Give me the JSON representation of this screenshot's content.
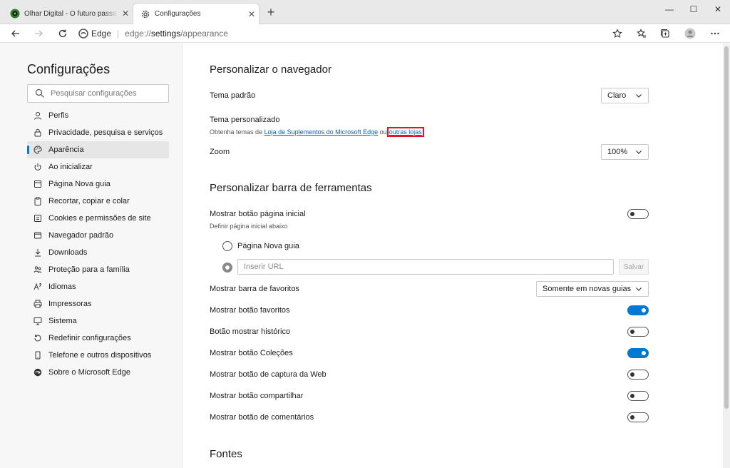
{
  "browser": {
    "tabs": [
      {
        "title": "Olhar Digital - O futuro passa pr",
        "favicon": "olhar-digital-logo",
        "active": false
      },
      {
        "title": "Configurações",
        "favicon": "gear-icon",
        "active": true
      }
    ],
    "new_tab_label": "+",
    "address": {
      "identity": "Edge",
      "separator": "|",
      "url_prefix": "edge://",
      "url_host": "settings",
      "url_path": "/appearance"
    }
  },
  "sidebar": {
    "title": "Configurações",
    "search_placeholder": "Pesquisar configurações",
    "items": [
      {
        "label": "Perfis",
        "icon": "person-icon"
      },
      {
        "label": "Privacidade, pesquisa e serviços",
        "icon": "lock-icon"
      },
      {
        "label": "Aparência",
        "icon": "palette-icon",
        "selected": true
      },
      {
        "label": "Ao inicializar",
        "icon": "power-icon"
      },
      {
        "label": "Página Nova guia",
        "icon": "new-tab-icon"
      },
      {
        "label": "Recortar, copiar e colar",
        "icon": "clipboard-icon"
      },
      {
        "label": "Cookies e permissões de site",
        "icon": "site-permissions-icon"
      },
      {
        "label": "Navegador padrão",
        "icon": "browser-icon"
      },
      {
        "label": "Downloads",
        "icon": "download-icon"
      },
      {
        "label": "Proteção para a família",
        "icon": "family-icon"
      },
      {
        "label": "Idiomas",
        "icon": "language-icon"
      },
      {
        "label": "Impressoras",
        "icon": "printer-icon"
      },
      {
        "label": "Sistema",
        "icon": "system-icon"
      },
      {
        "label": "Redefinir configurações",
        "icon": "reset-icon"
      },
      {
        "label": "Telefone e outros dispositivos",
        "icon": "phone-icon"
      },
      {
        "label": "Sobre o Microsoft Edge",
        "icon": "edge-logo-icon"
      }
    ]
  },
  "main": {
    "customize_browser": {
      "title": "Personalizar o navegador",
      "default_theme_label": "Tema padrão",
      "default_theme_value": "Claro",
      "custom_theme_label": "Tema personalizado",
      "custom_theme_desc_prefix": "Obtenha temas de ",
      "custom_theme_link": "Loja de Suplementos do Microsoft Edge",
      "custom_theme_or": " ou",
      "custom_theme_other_link": "outras lojas",
      "zoom_label": "Zoom",
      "zoom_value": "100%"
    },
    "customize_toolbar": {
      "title": "Personalizar barra de ferramentas",
      "home_button_label": "Mostrar botão página inicial",
      "home_button_sub": "Definir página inicial abaixo",
      "radio_new_tab": "Página Nova guia",
      "url_placeholder": "Inserir URL",
      "save_label": "Salvar",
      "favorites_bar_label": "Mostrar barra de favoritos",
      "favorites_bar_value": "Somente em novas guias",
      "toggles": [
        {
          "label": "Mostrar botão favoritos",
          "on": true
        },
        {
          "label": "Botão mostrar histórico",
          "on": false
        },
        {
          "label": "Mostrar botão Coleções",
          "on": true
        },
        {
          "label": "Mostrar botão de captura da Web",
          "on": false
        },
        {
          "label": "Mostrar botão compartilhar",
          "on": false
        },
        {
          "label": "Mostrar botão de comentários",
          "on": false
        }
      ],
      "home_button_on": false
    },
    "fonts": {
      "title": "Fontes"
    }
  },
  "colors": {
    "accent": "#0078d4",
    "highlight_box": "#e81123",
    "link": "#0067b8"
  }
}
